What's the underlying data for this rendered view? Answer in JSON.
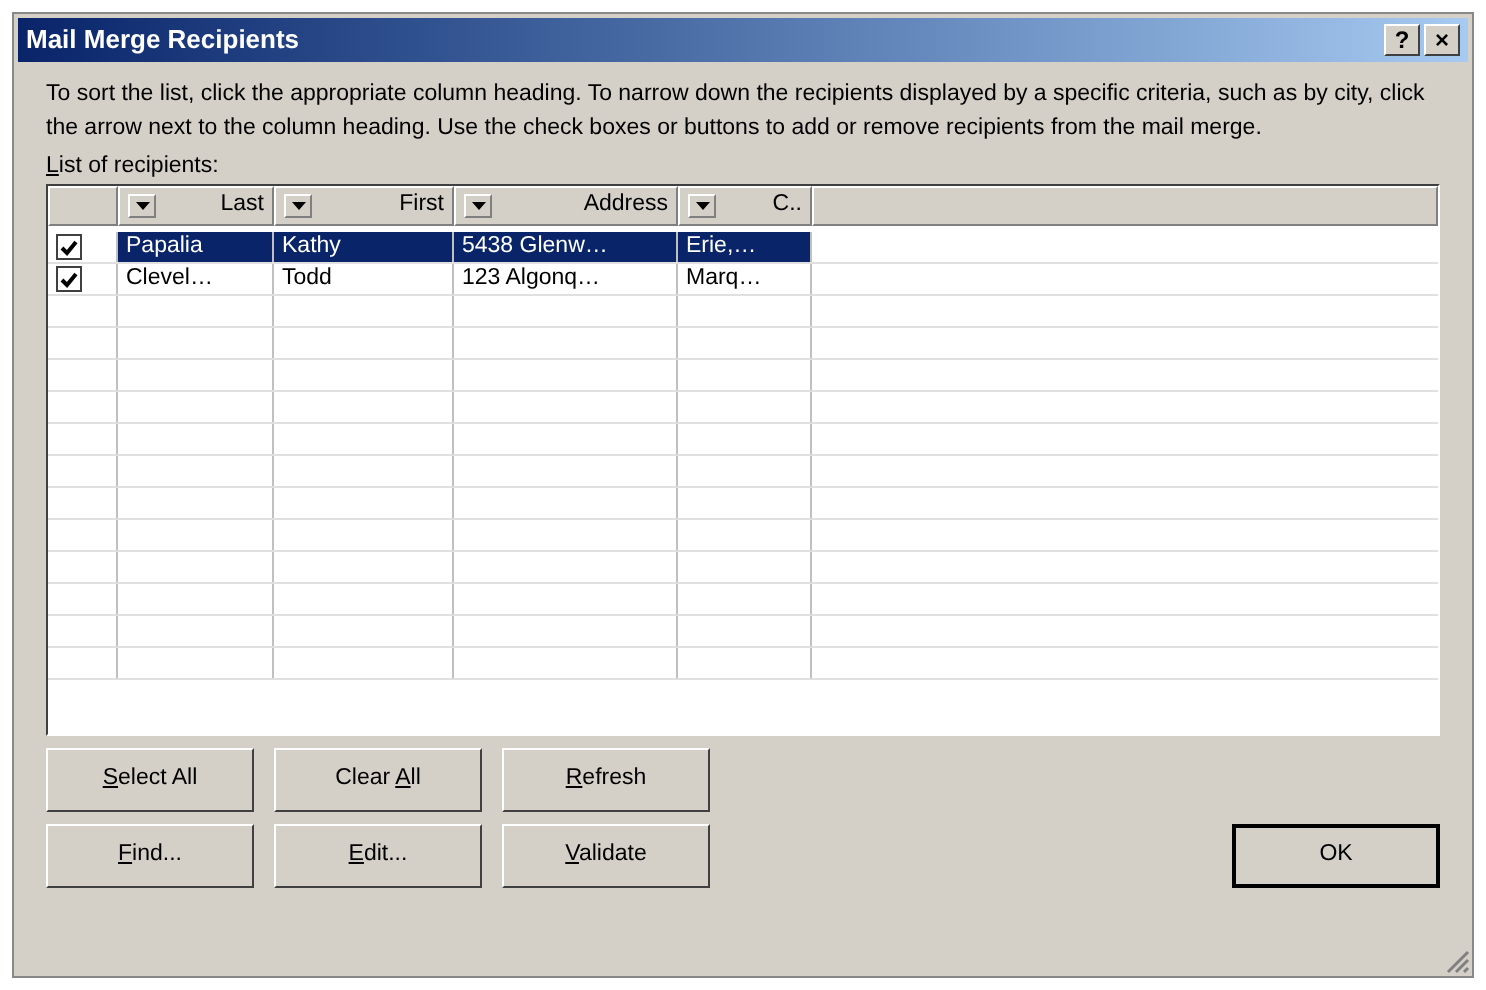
{
  "window": {
    "title": "Mail Merge Recipients",
    "title_buttons": [
      "?",
      "×"
    ]
  },
  "instructions": "To sort the list, click the appropriate column heading.  To narrow down the recipients displayed by a specific criteria, such as by city, click the arrow next to the column heading.  Use the check boxes or buttons to add or remove recipients from the mail merge.",
  "list_label": {
    "key": "L",
    "post": "ist of recipients:"
  },
  "table": {
    "columns": [
      "Last",
      "First",
      "Address",
      "C.."
    ],
    "rows": [
      {
        "checked": true,
        "selected": true,
        "cells": [
          "Papalia",
          "Kathy",
          "5438 Glenw…",
          "Erie,…"
        ]
      },
      {
        "checked": true,
        "selected": false,
        "cells": [
          "Clevel…",
          "Todd",
          "123 Algonq…",
          "Marq…"
        ]
      }
    ]
  },
  "buttons": [
    [
      {
        "key": "S",
        "post": "elect All"
      },
      {
        "pre": "Clear ",
        "key": "A",
        "post": "ll"
      },
      {
        "key": "R",
        "post": "efresh"
      }
    ],
    [
      {
        "key": "F",
        "post": "ind..."
      },
      {
        "key": "E",
        "post": "dit..."
      },
      {
        "key": "V",
        "post": "alidate"
      }
    ]
  ],
  "ok_button": "OK"
}
